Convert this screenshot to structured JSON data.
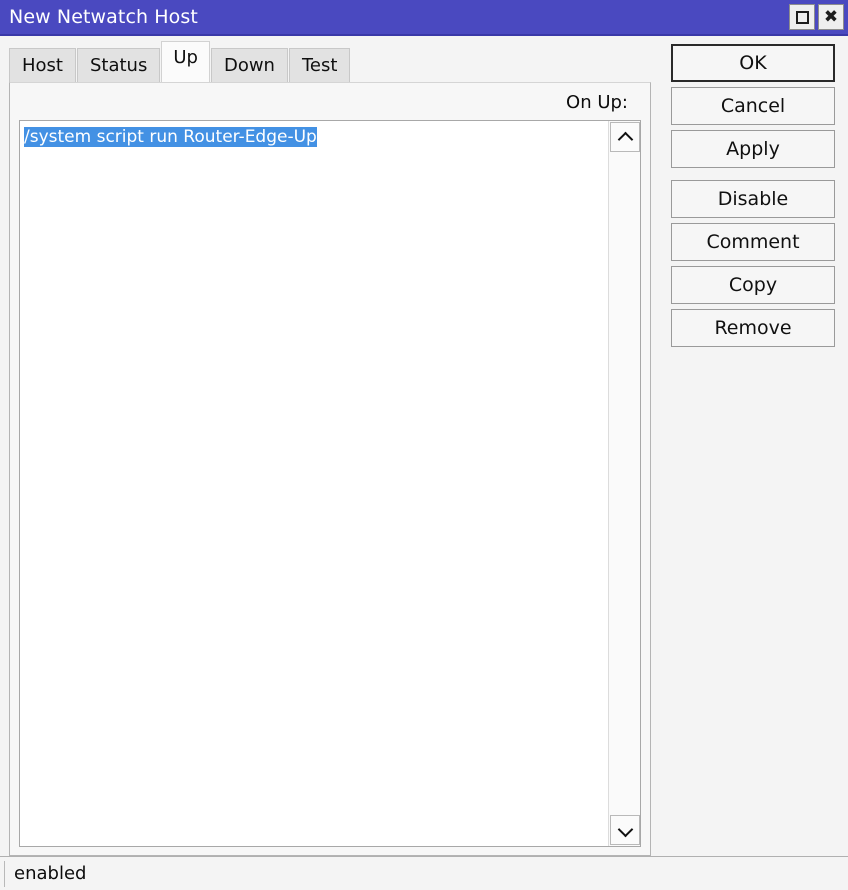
{
  "window": {
    "title": "New Netwatch Host",
    "titlebar_color": "#4a49c0",
    "controls": [
      {
        "name": "maximize",
        "glyph": "square"
      },
      {
        "name": "close",
        "glyph": "x"
      }
    ]
  },
  "tabs": [
    {
      "label": "Host",
      "active": false
    },
    {
      "label": "Status",
      "active": false
    },
    {
      "label": "Up",
      "active": true
    },
    {
      "label": "Down",
      "active": false
    },
    {
      "label": "Test",
      "active": false
    }
  ],
  "content": {
    "field_label": "On Up:",
    "script_value": "/system script run Router-Edge-Up",
    "selection_color": "#4391e4",
    "scroll_up_icon": "chevron-up-icon",
    "scroll_down_icon": "chevron-down-icon"
  },
  "buttons": [
    {
      "label": "OK",
      "default": true,
      "gap_before": false
    },
    {
      "label": "Cancel",
      "default": false,
      "gap_before": false
    },
    {
      "label": "Apply",
      "default": false,
      "gap_before": false
    },
    {
      "label": "Disable",
      "default": false,
      "gap_before": true
    },
    {
      "label": "Comment",
      "default": false,
      "gap_before": false
    },
    {
      "label": "Copy",
      "default": false,
      "gap_before": false
    },
    {
      "label": "Remove",
      "default": false,
      "gap_before": false
    }
  ],
  "statusbar": {
    "text": "enabled"
  }
}
